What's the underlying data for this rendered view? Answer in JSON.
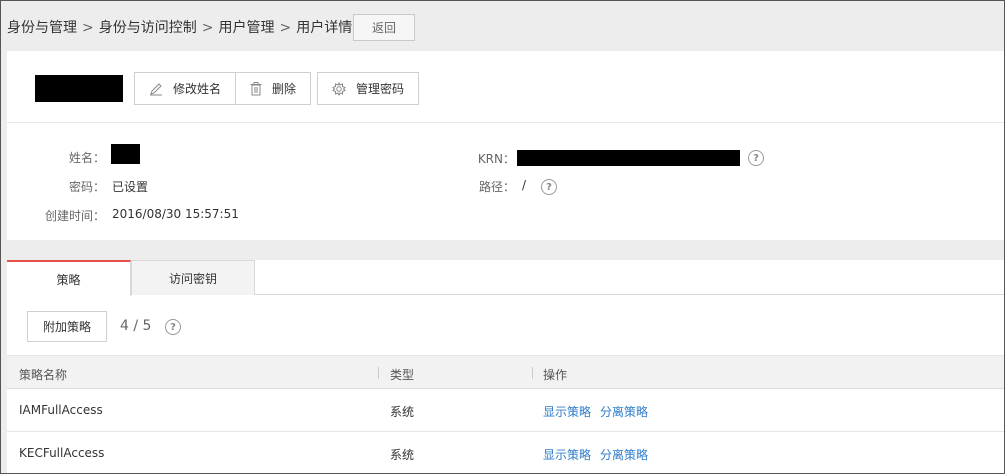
{
  "breadcrumb": {
    "items": [
      "身份与管理",
      "身份与访问控制",
      "用户管理",
      "用户详情"
    ],
    "separator": ">"
  },
  "header": {
    "back_label": "返回"
  },
  "toolbar": {
    "rename_label": "修改姓名",
    "delete_label": "删除",
    "password_label": "管理密码"
  },
  "info": {
    "name_label": "姓名：",
    "password_label": "密码：",
    "password_value": "已设置",
    "created_label": "创建时间：",
    "created_value": "2016/08/30 15:57:51",
    "krn_label": "KRN：",
    "path_label": "路径：",
    "path_value": "/"
  },
  "tabs": [
    {
      "label": "策略",
      "active": true
    },
    {
      "label": "访问密钥",
      "active": false
    }
  ],
  "policies": {
    "attach_label": "附加策略",
    "count": "4 / 5",
    "columns": [
      "策略名称",
      "类型",
      "操作"
    ],
    "rows": [
      {
        "name": "IAMFullAccess",
        "type": "系统",
        "actions": [
          "显示策略",
          "分离策略"
        ]
      },
      {
        "name": "KECFullAccess",
        "type": "系统",
        "actions": [
          "显示策略",
          "分离策略"
        ]
      }
    ]
  },
  "colors": {
    "link": "#2f7dcb",
    "active_tab_accent": "#e8504a",
    "page_bg": "#ededed"
  },
  "icons": {
    "rename": "pencil-icon",
    "delete": "trash-icon",
    "password": "gear-icon",
    "help": "question-circle-icon"
  }
}
